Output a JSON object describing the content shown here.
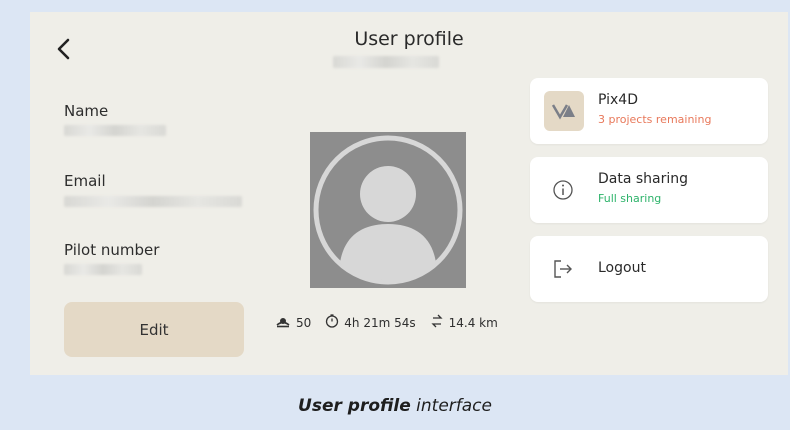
{
  "header": {
    "title": "User profile"
  },
  "fields": {
    "name_label": "Name",
    "email_label": "Email",
    "pilot_label": "Pilot number",
    "edit_label": "Edit"
  },
  "stats": {
    "flights": "50",
    "duration": "4h 21m 54s",
    "distance": "14.4 km"
  },
  "cards": {
    "pix4d": {
      "title": "Pix4D",
      "subtitle": "3 projects remaining",
      "subtitle_color": "#e8785a"
    },
    "sharing": {
      "title": "Data sharing",
      "subtitle": "Full sharing",
      "subtitle_color": "#2db36a"
    },
    "logout": {
      "title": "Logout"
    }
  },
  "caption": {
    "bold": "User profile",
    "rest": " interface"
  },
  "icons": [
    "back-arrow-icon",
    "avatar-placeholder-icon",
    "flights-icon",
    "timer-icon",
    "distance-icon",
    "pix4d-logo-icon",
    "info-icon",
    "logout-icon"
  ]
}
